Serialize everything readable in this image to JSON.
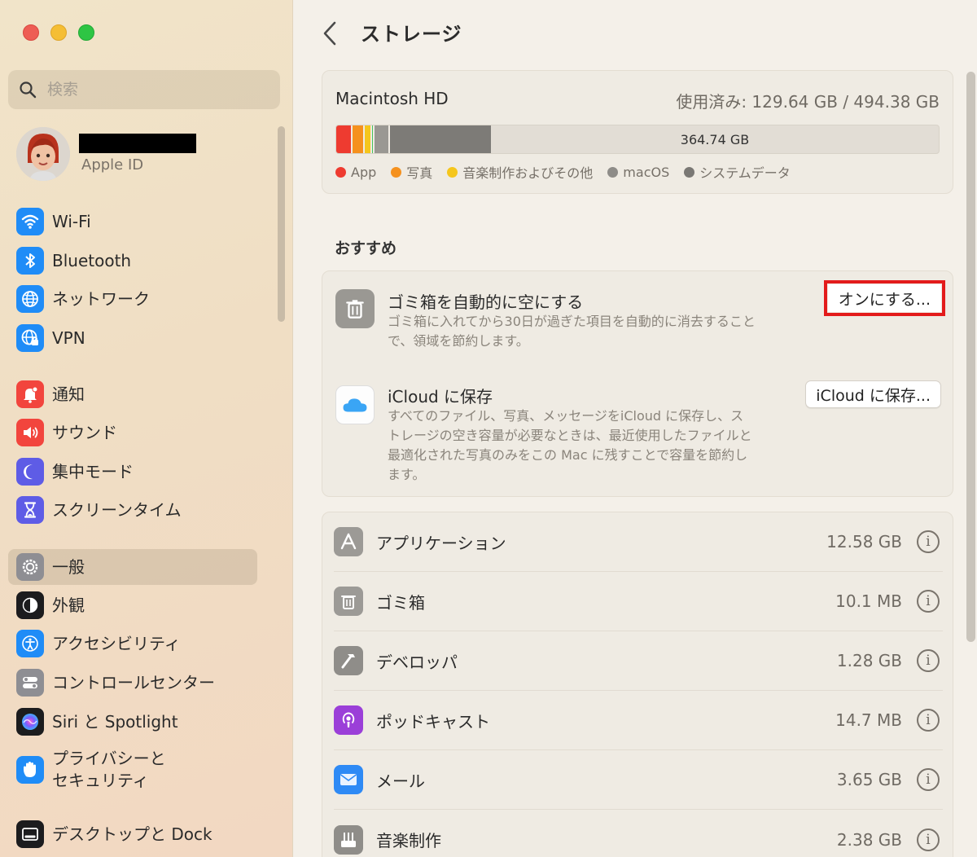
{
  "window": {
    "controls": [
      "close",
      "minimize",
      "zoom"
    ]
  },
  "sidebar": {
    "search": {
      "placeholder": "検索",
      "value": ""
    },
    "account": {
      "label": "Apple ID",
      "name_redacted": true
    },
    "items": [
      {
        "label": "Wi-Fi",
        "icon": "wifi-icon",
        "color": "#1f8cf7"
      },
      {
        "label": "Bluetooth",
        "icon": "bluetooth-icon",
        "color": "#1f8cf7"
      },
      {
        "label": "ネットワーク",
        "icon": "globe-icon",
        "color": "#1f8cf7"
      },
      {
        "label": "VPN",
        "icon": "vpn-globe-icon",
        "color": "#1f8cf7"
      },
      {
        "label": "通知",
        "icon": "bell-icon",
        "color": "#f2453d"
      },
      {
        "label": "サウンド",
        "icon": "speaker-icon",
        "color": "#f2453d"
      },
      {
        "label": "集中モード",
        "icon": "moon-icon",
        "color": "#5e5ce6"
      },
      {
        "label": "スクリーンタイム",
        "icon": "hourglass-icon",
        "color": "#5e5ce6"
      },
      {
        "label": "一般",
        "icon": "gear-icon",
        "color": "#8e8e93",
        "selected": true
      },
      {
        "label": "外観",
        "icon": "appearance-icon",
        "color": "#1c1c1e"
      },
      {
        "label": "アクセシビリティ",
        "icon": "accessibility-icon",
        "color": "#1f8cf7"
      },
      {
        "label": "コントロールセンター",
        "icon": "toggles-icon",
        "color": "#8e8e93"
      },
      {
        "label": "Siri と Spotlight",
        "icon": "siri-icon",
        "color": "#1c1c1e"
      },
      {
        "label": "プライバシーと\nセキュリティ",
        "icon": "hand-icon",
        "color": "#1f8cf7"
      },
      {
        "label": "デスクトップと Dock",
        "icon": "dock-icon",
        "color": "#1c1c1e"
      }
    ]
  },
  "main": {
    "title": "ストレージ",
    "disk": {
      "name": "Macintosh HD",
      "usage": "使用済み: 129.64 GB / 494.38 GB",
      "free_label": "364.74 GB",
      "used_gb": 129.64,
      "total_gb": 494.38,
      "segments": [
        {
          "name": "App",
          "fraction": 0.024,
          "color": "#ee3b30"
        },
        {
          "name": "写真",
          "fraction": 0.02,
          "color": "#f5911e"
        },
        {
          "name": "音楽制作およびその他",
          "fraction": 0.012,
          "color": "#f5c61c"
        },
        {
          "name": "other-green",
          "fraction": 0.004,
          "color": "#44c25a"
        },
        {
          "name": "macOS",
          "fraction": 0.026,
          "color": "#9a9893"
        },
        {
          "name": "システムデータ",
          "fraction": 0.17,
          "color": "#7d7b77"
        }
      ],
      "legend": [
        {
          "label": "App",
          "color": "#ee3b30"
        },
        {
          "label": "写真",
          "color": "#f5911e"
        },
        {
          "label": "音楽制作およびその他",
          "color": "#f5c61c"
        },
        {
          "label": "macOS",
          "color": "#8e8c88"
        },
        {
          "label": "システムデータ",
          "color": "#7a7874"
        }
      ]
    },
    "recommend_title": "おすすめ",
    "recommendations": [
      {
        "title": "ゴミ箱を自動的に空にする",
        "desc1": "ゴミ箱に入れてから30日が過ぎた項目を自動的に消去すること",
        "desc2": "で、領域を節約します。",
        "button": "オンにする..."
      },
      {
        "title": "iCloud に保存",
        "desc1": "すべてのファイル、写真、メッセージをiCloud に保存し、ス",
        "desc2": "トレージの空き容量が必要なときは、最近使用したファイルと",
        "desc3": "最適化された写真のみをこの Mac に残すことで容量を節約し",
        "desc4": "ます。",
        "button": "iCloud に保存..."
      }
    ],
    "categories": [
      {
        "label": "アプリケーション",
        "size": "12.58 GB",
        "icon": "apps-icon"
      },
      {
        "label": "ゴミ箱",
        "size": "10.1 MB",
        "icon": "trash-icon"
      },
      {
        "label": "デベロッパ",
        "size": "1.28 GB",
        "icon": "hammer-icon"
      },
      {
        "label": "ポッドキャスト",
        "size": "14.7 MB",
        "icon": "podcast-icon"
      },
      {
        "label": "メール",
        "size": "3.65 GB",
        "icon": "mail-icon"
      },
      {
        "label": "音楽制作",
        "size": "2.38 GB",
        "icon": "music-creation-icon"
      }
    ]
  }
}
